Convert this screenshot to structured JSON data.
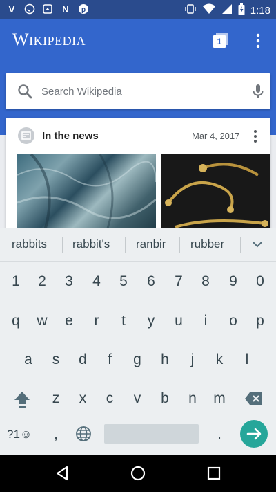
{
  "status_bar": {
    "time": "1:18",
    "left_icons": [
      "v-icon",
      "whatsapp-icon",
      "mms-icon",
      "n-icon",
      "pinterest-icon"
    ],
    "right_icons": [
      "vibrate-icon",
      "wifi-icon",
      "signal-icon",
      "battery-charging-icon"
    ]
  },
  "app_bar": {
    "logo": "Wikipedia",
    "tab_count": "1"
  },
  "search": {
    "placeholder": "Search Wikipedia"
  },
  "news_card": {
    "title": "In the news",
    "date": "Mar 4, 2017"
  },
  "suggestions": [
    "rabbits",
    "rabbit's",
    "ranbir",
    "rubber"
  ],
  "keyboard": {
    "row_numbers": [
      "1",
      "2",
      "3",
      "4",
      "5",
      "6",
      "7",
      "8",
      "9",
      "0"
    ],
    "row_top": [
      "q",
      "w",
      "e",
      "r",
      "t",
      "y",
      "u",
      "i",
      "o",
      "p"
    ],
    "row_mid": [
      "a",
      "s",
      "d",
      "f",
      "g",
      "h",
      "j",
      "k",
      "l"
    ],
    "row_bottom": [
      "z",
      "x",
      "c",
      "v",
      "b",
      "n",
      "m"
    ],
    "symbols_label": "?1☺",
    "comma": ",",
    "period": "."
  },
  "colors": {
    "status_bar": "#2a4b8d",
    "app_bar": "#3366cc",
    "keyboard_bg": "#eceff1",
    "enter_key": "#26a69a"
  }
}
